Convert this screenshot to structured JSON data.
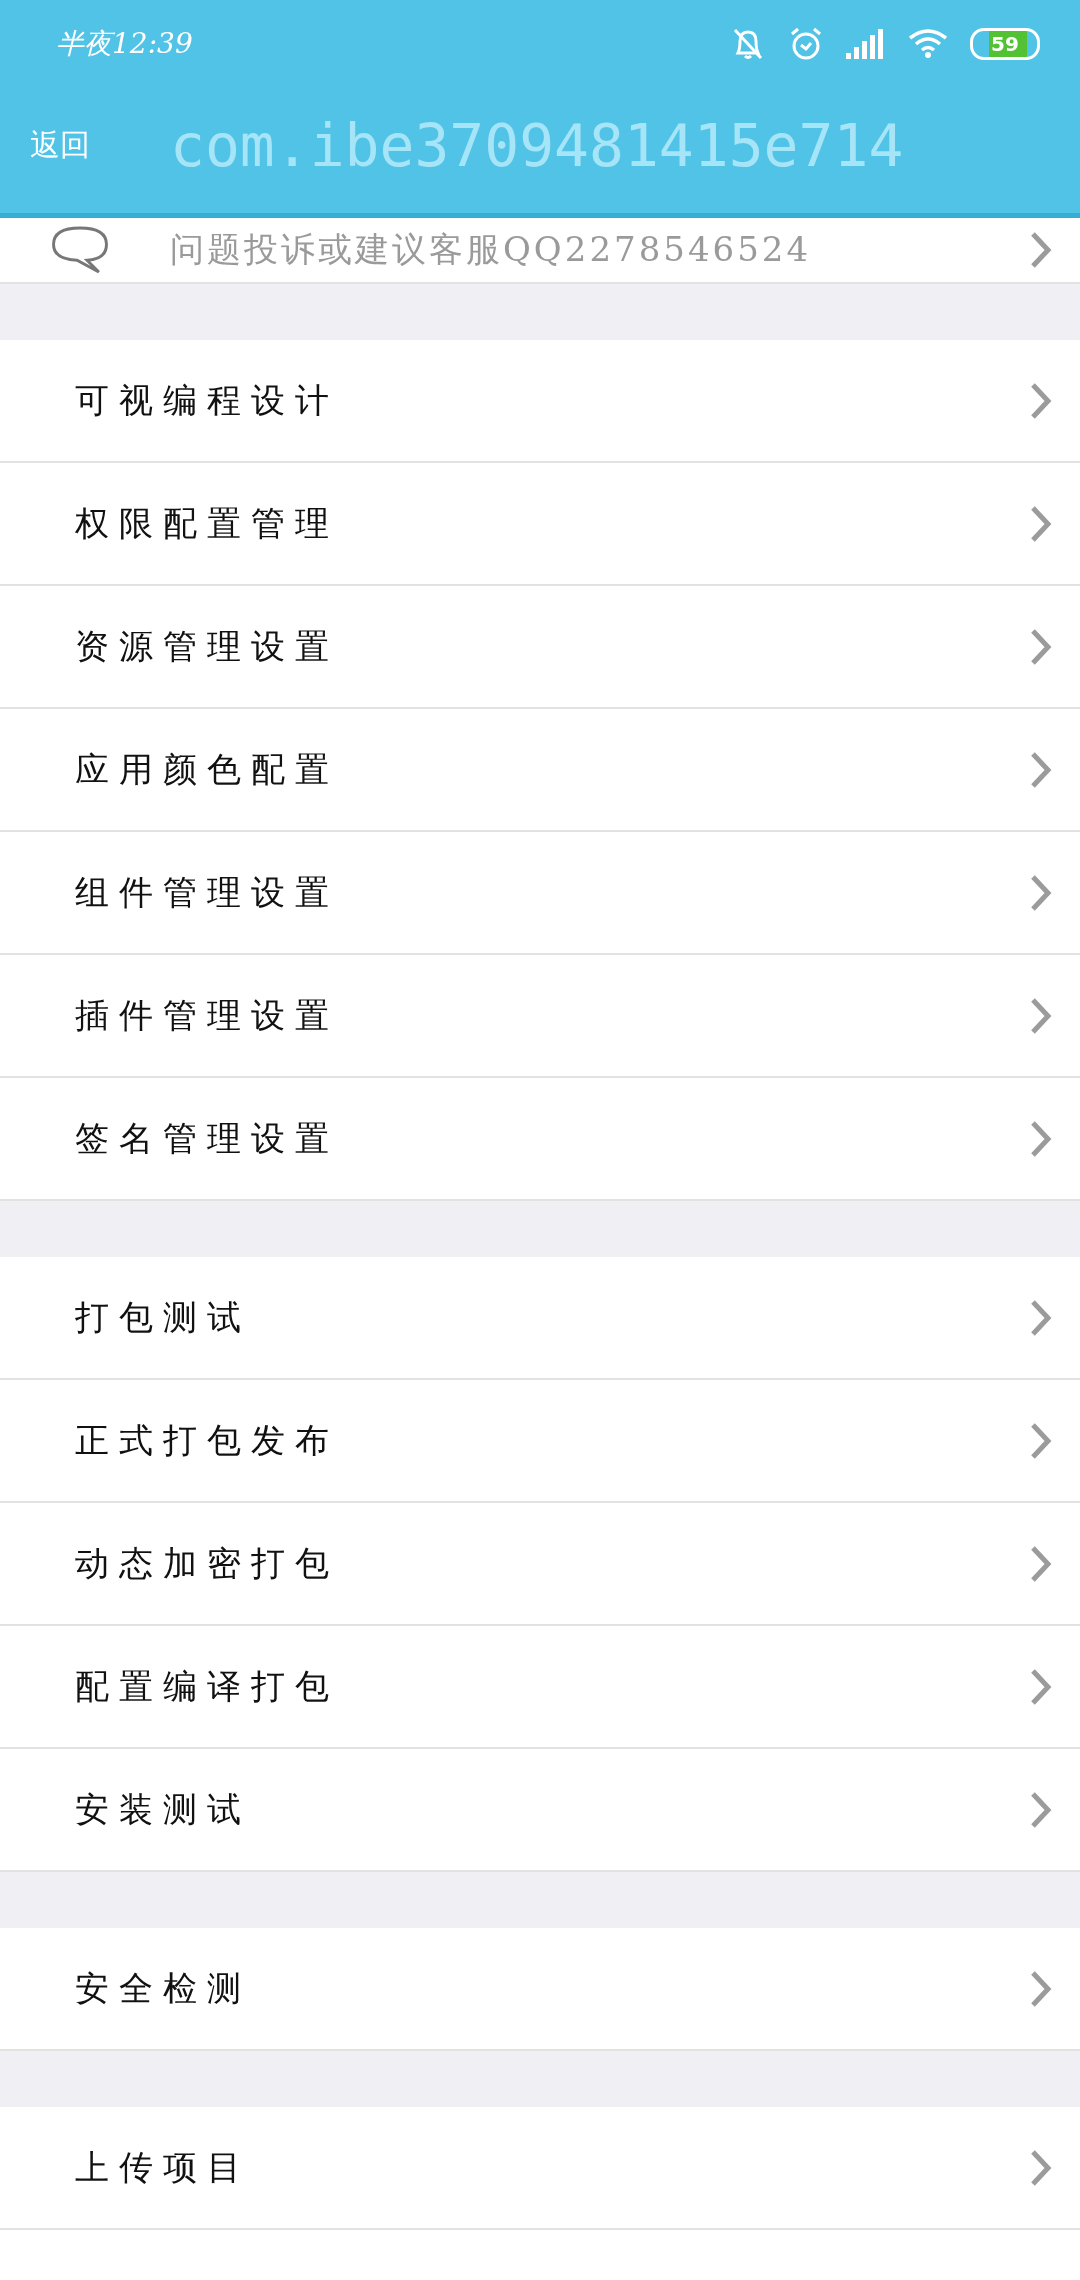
{
  "status_bar": {
    "time": "半夜12:39",
    "battery": "59"
  },
  "header": {
    "back": "返回",
    "title": "com.ibe3709481415e714"
  },
  "top_row": {
    "label": "问题投诉或建议客服QQ2278546524"
  },
  "groups": [
    {
      "items": [
        {
          "label": "可视编程设计"
        },
        {
          "label": "权限配置管理"
        },
        {
          "label": "资源管理设置"
        },
        {
          "label": "应用颜色配置"
        },
        {
          "label": "组件管理设置"
        },
        {
          "label": "插件管理设置"
        },
        {
          "label": "签名管理设置"
        }
      ]
    },
    {
      "items": [
        {
          "label": "打包测试"
        },
        {
          "label": "正式打包发布"
        },
        {
          "label": "动态加密打包"
        },
        {
          "label": "配置编译打包"
        },
        {
          "label": "安装测试"
        }
      ]
    },
    {
      "items": [
        {
          "label": "安全检测"
        }
      ]
    },
    {
      "items": [
        {
          "label": "上传项目"
        }
      ]
    }
  ]
}
